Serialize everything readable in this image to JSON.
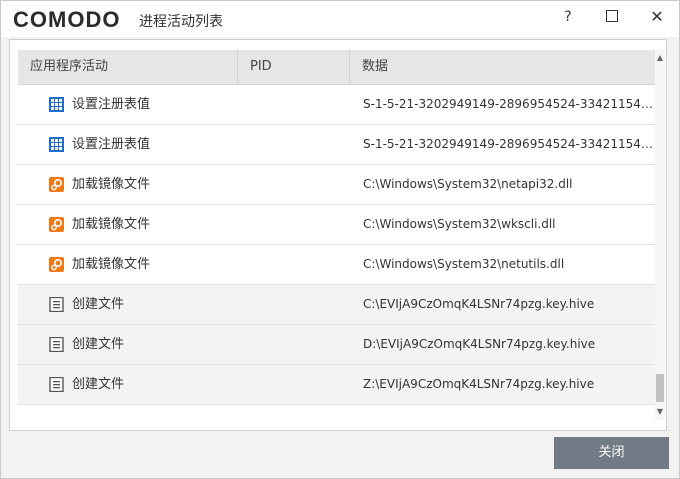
{
  "window": {
    "logo": "COMODO",
    "title": "进程活动列表",
    "help_label": "?",
    "close_label": "✕"
  },
  "table": {
    "columns": [
      "应用程序活动",
      "PID",
      "数据"
    ],
    "rows": [
      {
        "activity": "设置注册表值",
        "pid": "",
        "data": "S-1-5-21-3202949149-2896954524-334211545...",
        "icon": "registry-grid-icon"
      },
      {
        "activity": "设置注册表值",
        "pid": "",
        "data": "S-1-5-21-3202949149-2896954524-334211545...",
        "icon": "registry-grid-icon"
      },
      {
        "activity": "加载镜像文件",
        "pid": "",
        "data": "C:\\Windows\\System32\\netapi32.dll",
        "icon": "gear-icon"
      },
      {
        "activity": "加载镜像文件",
        "pid": "",
        "data": "C:\\Windows\\System32\\wkscli.dll",
        "icon": "gear-icon"
      },
      {
        "activity": "加载镜像文件",
        "pid": "",
        "data": "C:\\Windows\\System32\\netutils.dll",
        "icon": "gear-icon"
      },
      {
        "activity": "创建文件",
        "pid": "",
        "data": "C:\\EVIjA9CzOmqK4LSNr74pzg.key.hive",
        "icon": "file-icon"
      },
      {
        "activity": "创建文件",
        "pid": "",
        "data": "D:\\EVIjA9CzOmqK4LSNr74pzg.key.hive",
        "icon": "file-icon"
      },
      {
        "activity": "创建文件",
        "pid": "",
        "data": "Z:\\EVIjA9CzOmqK4LSNr74pzg.key.hive",
        "icon": "file-icon"
      }
    ]
  },
  "footer": {
    "close_button": "关闭"
  },
  "colors": {
    "registry_icon": "#1f6fd1",
    "gear_icon": "#f07a1a",
    "file_icon": "#555555",
    "close_button_bg": "#717a85"
  }
}
